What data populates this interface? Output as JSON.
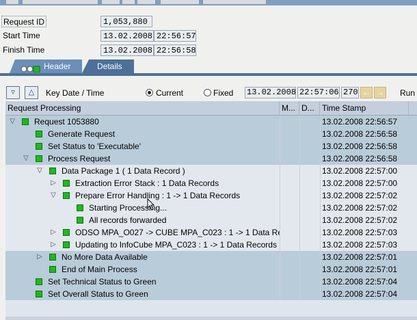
{
  "info": {
    "request_id_label": "Request ID",
    "request_id_value": "1,053,880",
    "start_time_label": "Start Time",
    "start_date": "13.02.2008",
    "start_time": "22:56:57",
    "finish_time_label": "Finish Time",
    "finish_date": "13.02.2008",
    "finish_time": "22:56:58"
  },
  "tabs": {
    "header": "Header",
    "details": "Details"
  },
  "controls": {
    "key_date_label": "Key Date / Time",
    "current_label": "Current",
    "fixed_label": "Fixed",
    "date_value": "13.02.2008",
    "time_value": "22:57:06",
    "number_value": "270",
    "run_label": "Run"
  },
  "table": {
    "columns": [
      "Request Processing",
      "M...",
      "D...",
      "Time Stamp"
    ],
    "rows": [
      {
        "indent": 0,
        "expander": "open",
        "led": true,
        "text": "Request 1053880",
        "ts": "13.02.2008 22:56:57",
        "style": "sel"
      },
      {
        "indent": 1,
        "expander": "none",
        "led": true,
        "text": "Generate Request",
        "ts": "13.02.2008 22:56:58",
        "style": "sel"
      },
      {
        "indent": 1,
        "expander": "none",
        "led": true,
        "text": "Set Status to 'Executable'",
        "ts": "13.02.2008 22:56:58",
        "style": "sel"
      },
      {
        "indent": 1,
        "expander": "open",
        "led": true,
        "text": "Process Request",
        "ts": "13.02.2008 22:56:58",
        "style": "sel"
      },
      {
        "indent": 2,
        "expander": "open",
        "led": true,
        "text": "Data Package 1 ( 1 Data Record )",
        "ts": "13.02.2008 22:57:00",
        "style": "plain"
      },
      {
        "indent": 3,
        "expander": "closed",
        "led": true,
        "text": "Extraction Error Stack : 1 Data Records",
        "ts": "13.02.2008 22:57:00",
        "style": "plain"
      },
      {
        "indent": 3,
        "expander": "open",
        "led": true,
        "text": "Prepare Error Handling : 1 -> 1 Data Records",
        "ts": "13.02.2008 22:57:02",
        "style": "plain"
      },
      {
        "indent": 4,
        "expander": "none",
        "led": true,
        "text": "Starting Processing...",
        "ts": "13.02.2008 22:57:02",
        "style": "plain"
      },
      {
        "indent": 4,
        "expander": "none",
        "led": true,
        "text": "All records forwarded",
        "ts": "13.02.2008 22:57:02",
        "style": "plain"
      },
      {
        "indent": 3,
        "expander": "closed",
        "led": true,
        "text": "ODSO MPA_O027 -> CUBE MPA_C023 : 1 -> 1 Data Re",
        "ts": "13.02.2008 22:57:03",
        "style": "plain"
      },
      {
        "indent": 3,
        "expander": "closed",
        "led": true,
        "text": "Updating to InfoCube MPA_C023 : 1 -> 1 Data Records",
        "ts": "13.02.2008 22:57:03",
        "style": "plain"
      },
      {
        "indent": 2,
        "expander": "closed",
        "led": true,
        "text": "No More Data Available",
        "ts": "13.02.2008 22:57:01",
        "style": "sel"
      },
      {
        "indent": 2,
        "expander": "none",
        "led": true,
        "text": "End of Main Process",
        "ts": "13.02.2008 22:57:01",
        "style": "sel"
      },
      {
        "indent": 1,
        "expander": "none",
        "led": true,
        "text": "Set Technical Status to Green",
        "ts": "13.02.2008 22:57:04",
        "style": "sel"
      },
      {
        "indent": 1,
        "expander": "none",
        "led": true,
        "text": "Set Overall Status to Green",
        "ts": "13.02.2008 22:57:04",
        "style": "sel"
      }
    ]
  },
  "colors": {
    "led_green": "#1dba1d",
    "tab_active": "#4d7099",
    "selected_row": "#b9ccd9"
  }
}
